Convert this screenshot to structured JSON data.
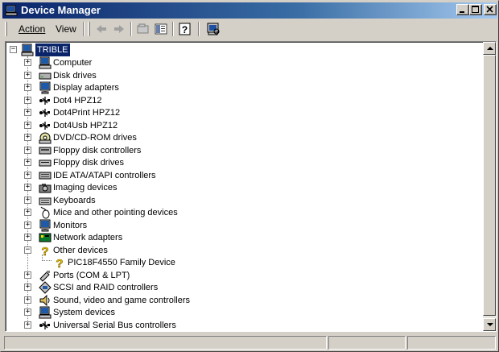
{
  "window": {
    "title": "Device Manager",
    "title_icon": "device-manager-icon",
    "title_color": "#0a246a"
  },
  "menu": {
    "action": "Action",
    "view": "View"
  },
  "toolbar": {
    "buttons": [
      "back-arrow-icon",
      "forward-arrow-icon",
      "properties-icon",
      "show-hide-tree-icon",
      "help-icon",
      "scan-hardware-icon"
    ]
  },
  "tree": {
    "root": {
      "label": "TRIBLE",
      "icon": "computer-icon",
      "expander": "−"
    },
    "items": [
      {
        "label": "Computer",
        "icon": "computer-icon",
        "expander": "+"
      },
      {
        "label": "Disk drives",
        "icon": "disk-drive-icon",
        "expander": "+"
      },
      {
        "label": "Display adapters",
        "icon": "monitor-icon",
        "expander": "+"
      },
      {
        "label": "Dot4 HPZ12",
        "icon": "usb-icon",
        "expander": "+"
      },
      {
        "label": "Dot4Print HPZ12",
        "icon": "usb-icon",
        "expander": "+"
      },
      {
        "label": "Dot4Usb HPZ12",
        "icon": "usb-icon",
        "expander": "+"
      },
      {
        "label": "DVD/CD-ROM drives",
        "icon": "cd-drive-icon",
        "expander": "+"
      },
      {
        "label": "Floppy disk controllers",
        "icon": "floppy-controller-icon",
        "expander": "+"
      },
      {
        "label": "Floppy disk drives",
        "icon": "floppy-drive-icon",
        "expander": "+"
      },
      {
        "label": "IDE ATA/ATAPI controllers",
        "icon": "ide-controller-icon",
        "expander": "+"
      },
      {
        "label": "Imaging devices",
        "icon": "camera-icon",
        "expander": "+"
      },
      {
        "label": "Keyboards",
        "icon": "keyboard-icon",
        "expander": "+"
      },
      {
        "label": "Mice and other pointing devices",
        "icon": "mouse-icon",
        "expander": "+"
      },
      {
        "label": "Monitors",
        "icon": "monitor-icon",
        "expander": "+"
      },
      {
        "label": "Network adapters",
        "icon": "network-adapter-icon",
        "expander": "+"
      },
      {
        "label": "Other devices",
        "icon": "question-icon",
        "expander": "−"
      },
      {
        "label": "PIC18F4550 Family Device",
        "icon": "question-icon",
        "expander": "",
        "child": true
      },
      {
        "label": "Ports (COM & LPT)",
        "icon": "port-icon",
        "expander": "+"
      },
      {
        "label": "SCSI and RAID controllers",
        "icon": "scsi-icon",
        "expander": "+"
      },
      {
        "label": "Sound, video and game controllers",
        "icon": "speaker-icon",
        "expander": "+"
      },
      {
        "label": "System devices",
        "icon": "computer-icon",
        "expander": "+"
      },
      {
        "label": "Universal Serial Bus controllers",
        "icon": "usb-icon",
        "expander": "+"
      }
    ]
  },
  "status": {
    "panes": [
      "",
      "",
      ""
    ]
  }
}
